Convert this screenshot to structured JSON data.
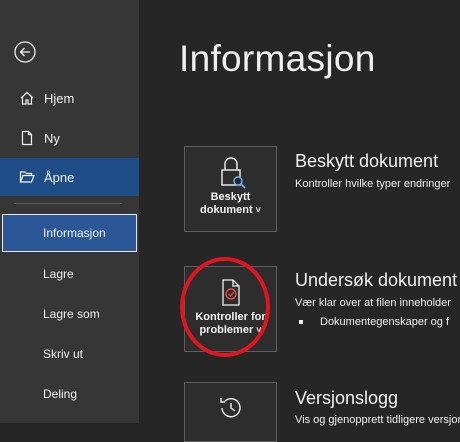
{
  "sidebar": {
    "items": [
      {
        "label": "Hjem",
        "icon": "home-icon"
      },
      {
        "label": "Ny",
        "icon": "new-document-icon"
      },
      {
        "label": "Åpne",
        "icon": "folder-open-icon"
      }
    ],
    "text_items": [
      {
        "label": "Informasjon"
      },
      {
        "label": "Lagre"
      },
      {
        "label": "Lagre som"
      },
      {
        "label": "Skriv ut"
      },
      {
        "label": "Deling"
      }
    ]
  },
  "main": {
    "title": "Informasjon",
    "sections": [
      {
        "tile_label": "Beskytt dokument",
        "tile_line1": "Beskytt",
        "tile_line2": "dokument",
        "title": "Beskytt dokument",
        "desc": "Kontroller hvilke typer endringer"
      },
      {
        "tile_line1": "Kontroller for",
        "tile_line2": "problemer",
        "title": "Undersøk dokument",
        "desc": "Vær klar over at filen inneholder",
        "bullet": "Dokumentegenskaper og f"
      },
      {
        "title": "Versjonslogg",
        "desc": "Vis og gjenopprett tidligere versjon"
      }
    ]
  },
  "colors": {
    "sidebar_bg": "#363636",
    "main_bg": "#262626",
    "selected_bg": "#2b5797",
    "open_bg": "#1f4d87",
    "annotation_ring": "#e0151f"
  }
}
